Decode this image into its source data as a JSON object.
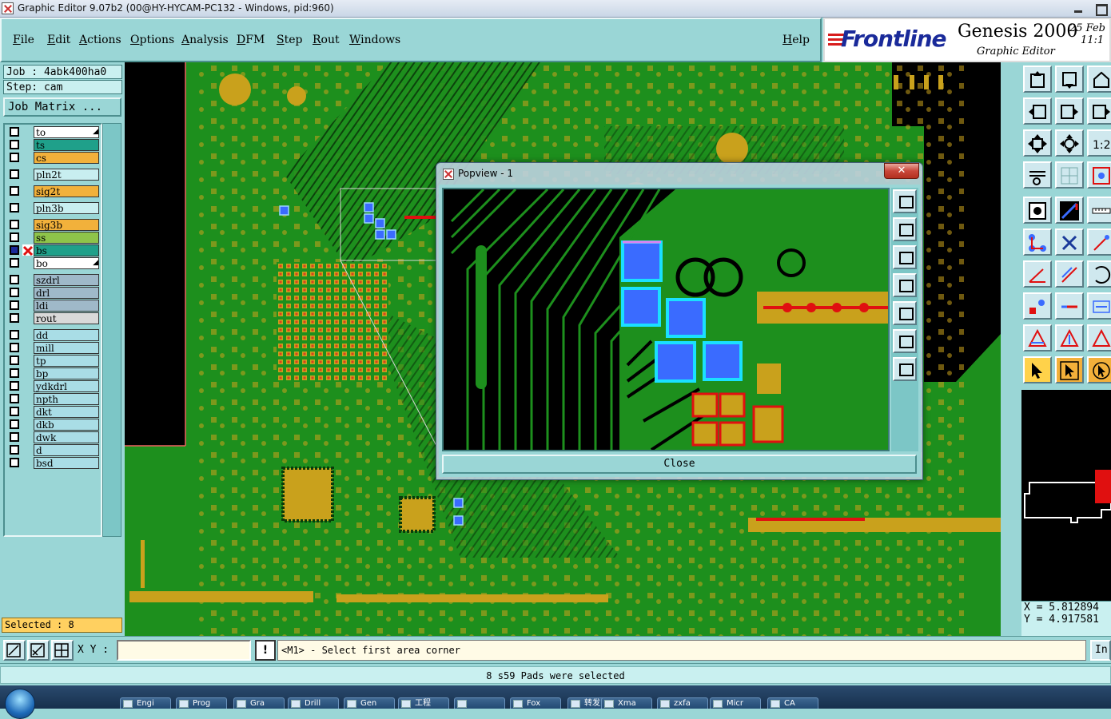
{
  "window": {
    "title": "Graphic Editor 9.07b2 (00@HY-HYCAM-PC132 - Windows, pid:960)"
  },
  "menu": [
    "File",
    "Edit",
    "Actions",
    "Options",
    "Analysis",
    "DFM",
    "Step",
    "Rout",
    "Windows"
  ],
  "help_label": "Help",
  "logo": {
    "brand": "Frontline",
    "product": "Genesis 2000",
    "subtitle": "Graphic Editor",
    "date": "25 Feb",
    "time": "11:1"
  },
  "job": {
    "job_text": "Job : 4abk400ha0",
    "step_text": "Step: cam",
    "matrix_button": "Job Matrix ..."
  },
  "layers": [
    {
      "name": "to",
      "color": "#ffffff",
      "arrow": true
    },
    {
      "name": "ts",
      "color": "#1fa08a"
    },
    {
      "name": "cs",
      "color": "#f2b13b"
    },
    {
      "name": "pln2t",
      "color": "#c8eef0"
    },
    {
      "name": "sig2t",
      "color": "#f2b13b"
    },
    {
      "name": "pln3b",
      "color": "#c8eef0"
    },
    {
      "name": "sig3b",
      "color": "#f2b13b"
    },
    {
      "name": "ss",
      "color": "#8ec44a"
    },
    {
      "name": "bs",
      "color": "#1fa08a",
      "work": true
    },
    {
      "name": "bo",
      "color": "#ffffff",
      "arrow": true
    },
    {
      "name": "szdrl",
      "color": "#9fb9c9"
    },
    {
      "name": "drl",
      "color": "#9fb9c9"
    },
    {
      "name": "ldi",
      "color": "#9fb9c9"
    },
    {
      "name": "rout",
      "color": "#d9d9d9"
    },
    {
      "name": "dd",
      "color": "#a9dde6"
    },
    {
      "name": "mill",
      "color": "#a9dde6"
    },
    {
      "name": "tp",
      "color": "#a9dde6"
    },
    {
      "name": "bp",
      "color": "#a9dde6"
    },
    {
      "name": "ydkdrl",
      "color": "#a9dde6"
    },
    {
      "name": "npth",
      "color": "#a9dde6"
    },
    {
      "name": "dkt",
      "color": "#a9dde6"
    },
    {
      "name": "dkb",
      "color": "#a9dde6"
    },
    {
      "name": "dwk",
      "color": "#a9dde6"
    },
    {
      "name": "d",
      "color": "#a9dde6"
    },
    {
      "name": "bsd",
      "color": "#a9dde6"
    }
  ],
  "selected_text": "Selected : 8",
  "coords": {
    "x_text": "X = 5.812894",
    "y_text": "Y = 4.917581"
  },
  "bottom": {
    "xy_label": "X Y :",
    "xy_value": "",
    "prompt_icon": "!",
    "prompt": "<M1> - Select first area corner",
    "in_label": "In"
  },
  "status": "8 s59 Pads were selected",
  "popview": {
    "title": "Popview - 1",
    "close_label": "Close",
    "close_x": "✕"
  },
  "taskbar": [
    "",
    "Engi",
    "Prog",
    "Gra",
    "Drill",
    "Gen",
    "工程",
    "",
    "Fox",
    "转发",
    "Xma",
    "zxfa",
    "Micr",
    "CA"
  ],
  "colors": {
    "board": "#1d8f1d",
    "copper": "#c9a11c",
    "selected": "#3a6bff",
    "panel": "#9ad6d6"
  }
}
